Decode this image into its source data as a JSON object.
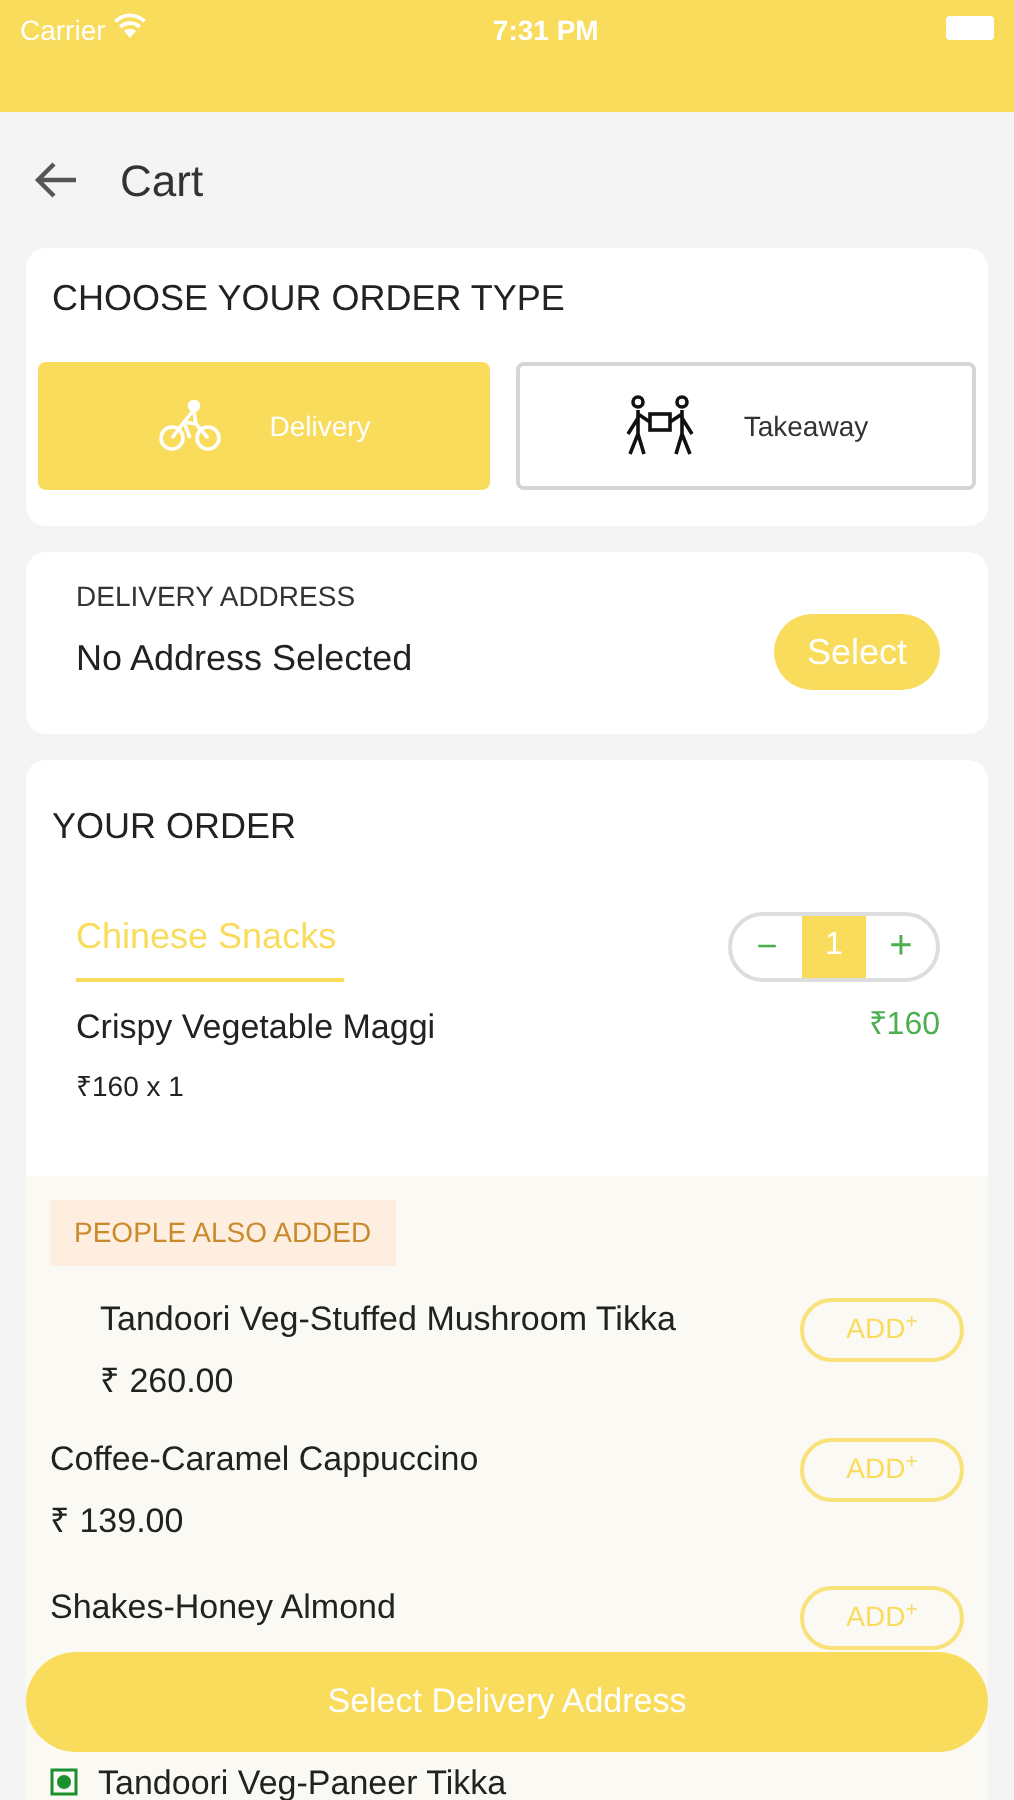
{
  "status_bar": {
    "carrier": "Carrier",
    "time": "7:31 PM"
  },
  "header": {
    "title": "Cart"
  },
  "order_type": {
    "title": "CHOOSE YOUR ORDER TYPE",
    "options": [
      {
        "kind": "delivery",
        "label": "Delivery",
        "selected": true
      },
      {
        "kind": "takeaway",
        "label": "Takeaway",
        "selected": false
      }
    ]
  },
  "address": {
    "label": "DELIVERY ADDRESS",
    "value": "No Address Selected",
    "button": "Select"
  },
  "order": {
    "title": "YOUR ORDER",
    "category": "Chinese Snacks",
    "stepper": {
      "minus": "−",
      "quantity": "1",
      "plus": "+"
    },
    "items": [
      {
        "name": "Crispy Vegetable Maggi",
        "price": "₹160",
        "detail": "₹160 x 1"
      }
    ]
  },
  "suggestions": {
    "title": "PEOPLE ALSO ADDED",
    "items": [
      {
        "name": "Tandoori Veg-Stuffed Mushroom Tikka",
        "price": "₹ 260.00",
        "add": "ADD$^{+}$",
        "veg": false
      },
      {
        "name": "Coffee-Caramel Cappuccino",
        "price": "₹ 139.00",
        "add": "ADD$^{+}$",
        "veg": false
      },
      {
        "name": "Shakes-Honey Almond",
        "add": "ADD$^{+}$",
        "veg": false
      },
      {
        "name": "Tandoori Veg-Paneer Tikka",
        "veg": true
      }
    ]
  },
  "bottom_button": "Select Delivery Address"
}
